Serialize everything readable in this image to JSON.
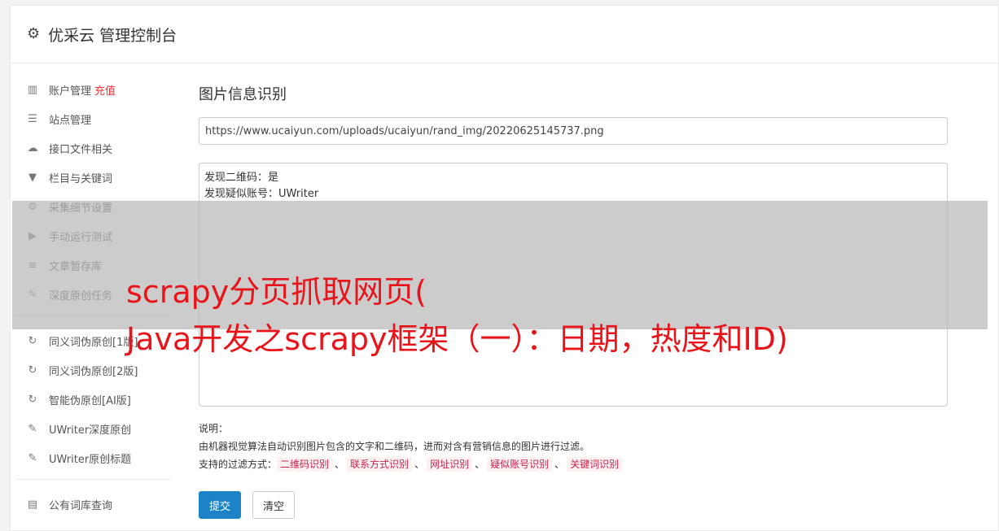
{
  "header": {
    "icon": "gear-icon",
    "title": "优采云 管理控制台"
  },
  "sidebar": {
    "group1": [
      {
        "icon": "bar-chart-icon",
        "label": "账户管理",
        "badge": "充值"
      },
      {
        "icon": "server-icon",
        "label": "站点管理"
      },
      {
        "icon": "cloud-upload-icon",
        "label": "接口文件相关"
      },
      {
        "icon": "filter-icon",
        "label": "栏目与关键词"
      },
      {
        "icon": "cogs-icon",
        "label": "采集细节设置"
      },
      {
        "icon": "play-circle-icon",
        "label": "手动运行测试"
      },
      {
        "icon": "database-icon",
        "label": "文章暂存库"
      },
      {
        "icon": "edit-icon",
        "label": "深度原创任务"
      }
    ],
    "group2": [
      {
        "icon": "refresh-icon",
        "label": "同义词伪原创[1版]"
      },
      {
        "icon": "refresh-icon",
        "label": "同义词伪原创[2版]"
      },
      {
        "icon": "refresh-icon",
        "label": "智能伪原创[AI版]"
      },
      {
        "icon": "edit-icon",
        "label": "UWriter深度原创"
      },
      {
        "icon": "edit-icon",
        "label": "UWriter原创标题"
      }
    ],
    "group3": [
      {
        "icon": "book-icon",
        "label": "公有词库查询"
      }
    ]
  },
  "main": {
    "title": "图片信息识别",
    "url_value": "https://www.ucaiyun.com/uploads/ucaiyun/rand_img/20220625145737.png",
    "result_text": "发现二维码：是\n发现疑似账号：UWriter",
    "notes_label": "说明：",
    "notes_desc": "由机器视觉算法自动识别图片包含的文字和二维码，进而对含有营销信息的图片进行过滤。",
    "filter_label": "支持的过滤方式：",
    "filter_sep": "、",
    "filters": [
      "二维码识别",
      "联系方式识别",
      "网址识别",
      "疑似账号识别",
      "关键词识别"
    ],
    "submit_label": "提交",
    "clear_label": "清空"
  },
  "overlay": {
    "text": "scrapy分页抓取网页(\nJava开发之scrapy框架（一）：日期，热度和ID)"
  },
  "colors": {
    "primary": "#1c84c6",
    "badge": "#e33333",
    "overlay_text": "#e8141a",
    "tag_text": "#c7254e"
  }
}
